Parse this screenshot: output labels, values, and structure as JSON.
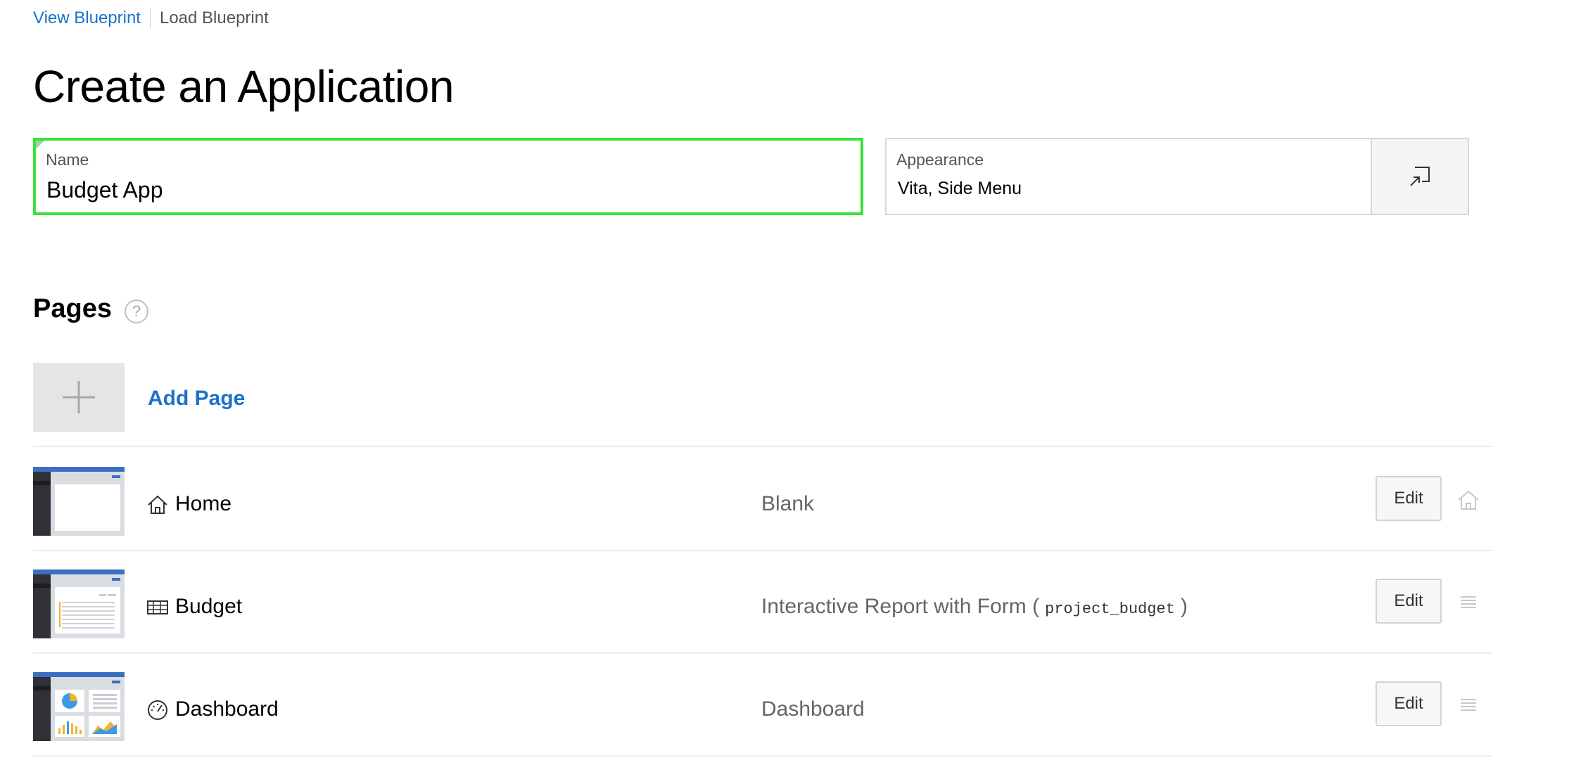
{
  "nav": {
    "view_blueprint": "View Blueprint",
    "load_blueprint": "Load Blueprint"
  },
  "title": "Create an Application",
  "name_field": {
    "label": "Name",
    "value": "Budget App"
  },
  "appearance_field": {
    "label": "Appearance",
    "value": "Vita, Side Menu"
  },
  "pages_section": {
    "title": "Pages",
    "help_glyph": "?",
    "add_page_label": "Add Page"
  },
  "pages": [
    {
      "name": "Home",
      "type": "Blank",
      "edit_label": "Edit",
      "icon": "home-icon",
      "end_icon": "home-icon"
    },
    {
      "name": "Budget",
      "type_prefix": "Interactive Report with Form (",
      "type_code": "project_budget",
      "type_suffix": ")",
      "edit_label": "Edit",
      "icon": "table-icon",
      "end_icon": "drag-handle-icon"
    },
    {
      "name": "Dashboard",
      "type": "Dashboard",
      "edit_label": "Edit",
      "icon": "gauge-icon",
      "end_icon": "drag-handle-icon"
    }
  ],
  "colors": {
    "accent": "#1a73c8",
    "focus_border": "#3ce23c",
    "thumb_header": "#3c6fc4",
    "thumb_sidebar": "#2f3136"
  }
}
